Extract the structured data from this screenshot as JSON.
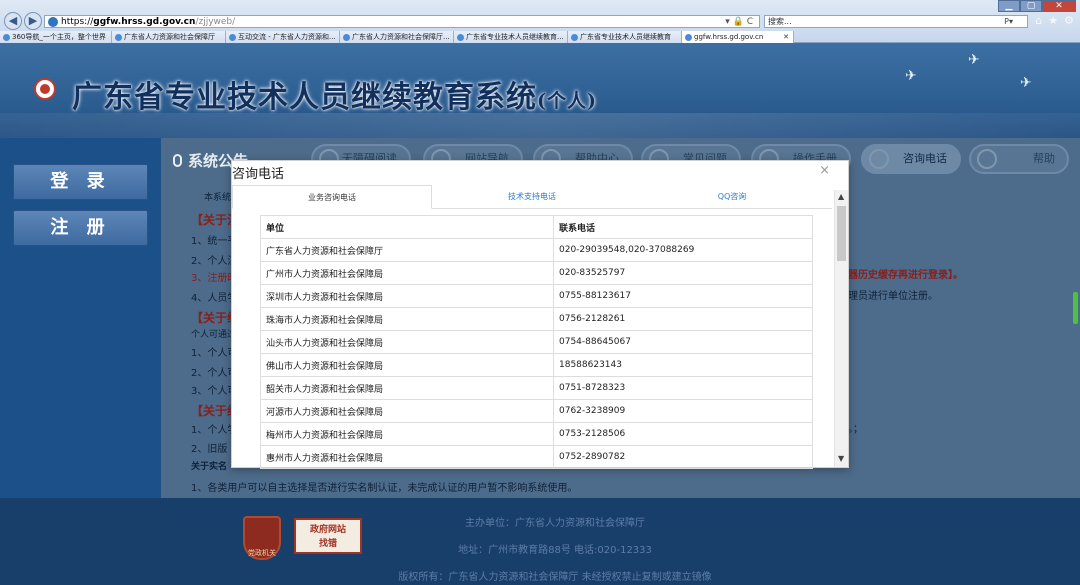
{
  "browser": {
    "url_protocol": "https://",
    "url_host": "ggfw.hrss.gd.gov.cn",
    "url_path": "/zjjyweb/",
    "addr_tools": "▾ 🔒 C",
    "search_placeholder": "搜索...",
    "search_icon": "P▾",
    "right_icons": [
      "⌂",
      "★",
      "⚙"
    ],
    "window_controls": [
      "▁",
      "▢",
      "✕"
    ],
    "nav": [
      "◀",
      "▶"
    ],
    "tabs": [
      {
        "label": "360导航_一个主页，整个世界",
        "active": false
      },
      {
        "label": "广东省人力资源和社会保障厅",
        "active": false
      },
      {
        "label": "互动交流 - 广东省人力资源和...",
        "active": false
      },
      {
        "label": "广东省人力资源和社会保障厅...",
        "active": false
      },
      {
        "label": "广东省专业技术人员继续教育...",
        "active": false
      },
      {
        "label": "广东省专业技术人员继续教育",
        "active": false
      },
      {
        "label": "ggfw.hrss.gd.gov.cn",
        "active": true
      }
    ],
    "tab_close": "✕"
  },
  "site": {
    "title": "广东省专业技术人员继续教育系统",
    "title_suffix": "(个人)",
    "login": "登 录",
    "register": "注 册",
    "notice_heading": "系统公告",
    "nav_items": [
      "无障碍阅读",
      "网站导航",
      "帮助中心",
      "常见问题",
      "操作手册",
      "咨询电话",
      "帮助"
    ],
    "notice_lines": [
      {
        "text": "本系统",
        "cls": ""
      },
      {
        "text": "【关于注",
        "cls": "red"
      },
      {
        "text": "1、统一平",
        "cls": ""
      },
      {
        "text": "2、个人注",
        "cls": ""
      },
      {
        "text": "3、注册时",
        "cls": "red2"
      },
      {
        "text": "4、人员学",
        "cls": ""
      },
      {
        "text": "【关于继",
        "cls": "red"
      },
      {
        "text": "个人可通过",
        "cls": ""
      },
      {
        "text": "1、个人可",
        "cls": ""
      },
      {
        "text": "2、个人可",
        "cls": ""
      },
      {
        "text": "3、个人可",
        "cls": ""
      },
      {
        "text": "【关于继",
        "cls": "red"
      },
      {
        "text": "1、个人学",
        "cls": ""
      },
      {
        "text": "2、旧版",
        "cls": ""
      },
      {
        "text": "关于实名",
        "cls": "b"
      },
      {
        "text": "1、各类用户可以自主选择是否进行实名制认证，未完成认证的用户暂不影响系统使用。",
        "cls": ""
      }
    ],
    "notice_right": [
      "器历史缓存再进行登录】。",
      "理员进行单位注册。",
      "。；"
    ],
    "footer": {
      "host": "主办单位：广东省人力资源和社会保障厅",
      "address": "地址：广州市教育路88号 电话:020-12333",
      "copyright": "版权所有：广东省人力资源和社会保障厅 未经授权禁止复制或建立镜像",
      "badge1": "党政机关",
      "badge2_line1": "政府网站",
      "badge2_line2": "找错"
    }
  },
  "modal": {
    "title": "咨询电话",
    "close": "×",
    "tabs": [
      {
        "label": "业务咨询电话",
        "active": true
      },
      {
        "label": "技术支持电话",
        "active": false
      },
      {
        "label": "QQ咨询",
        "active": false
      }
    ],
    "table": {
      "headers": [
        "单位",
        "联系电话"
      ],
      "rows": [
        [
          "广东省人力资源和社会保障厅",
          "020-29039548,020-37088269"
        ],
        [
          "广州市人力资源和社会保障局",
          "020-83525797"
        ],
        [
          "深圳市人力资源和社会保障局",
          "0755-88123617"
        ],
        [
          "珠海市人力资源和社会保障局",
          "0756-2128261"
        ],
        [
          "汕头市人力资源和社会保障局",
          "0754-88645067"
        ],
        [
          "佛山市人力资源和社会保障局",
          "18588623143"
        ],
        [
          "韶关市人力资源和社会保障局",
          "0751-8728323"
        ],
        [
          "河源市人力资源和社会保障局",
          "0762-3238909"
        ],
        [
          "梅州市人力资源和社会保障局",
          "0753-2128506"
        ],
        [
          "惠州市人力资源和社会保障局",
          "0752-2890782"
        ],
        [
          "",
          ""
        ]
      ]
    },
    "scroll_up": "▲",
    "scroll_down": "▼"
  }
}
